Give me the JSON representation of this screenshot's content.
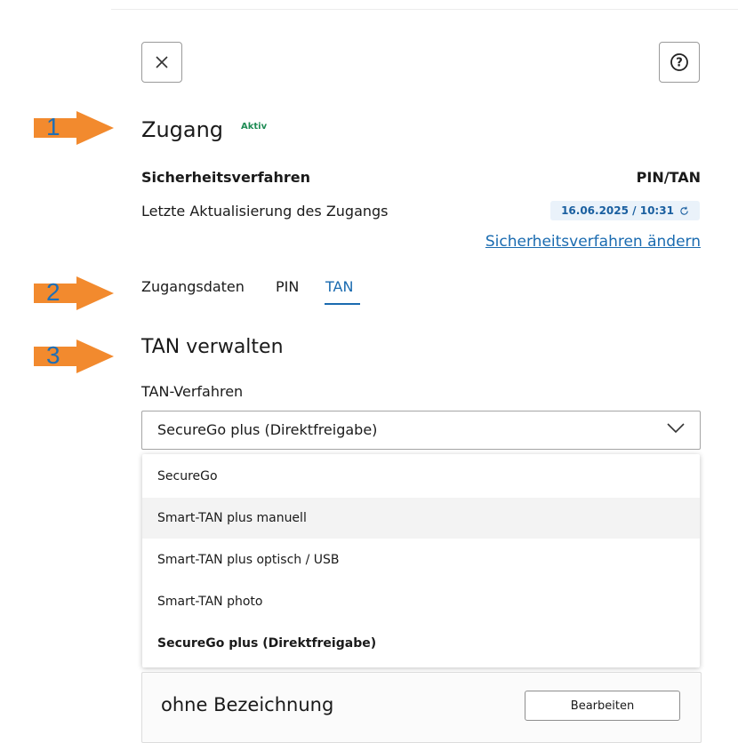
{
  "header": {
    "close_icon": "close-icon",
    "help_icon": "help-icon"
  },
  "markers": [
    "1",
    "2",
    "3"
  ],
  "access": {
    "title": "Zugang",
    "badge": "Aktiv",
    "security_label": "Sicherheitsverfahren",
    "security_value": "PIN/TAN",
    "last_update_label": "Letzte Aktualisierung des Zugangs",
    "last_update_value": "16.06.2025 / 10:31",
    "change_link": "Sicherheitsverfahren ändern"
  },
  "tabs": [
    {
      "label": "Zugangsdaten",
      "active": false
    },
    {
      "label": "PIN",
      "active": false
    },
    {
      "label": "TAN",
      "active": true
    }
  ],
  "tan": {
    "heading": "TAN verwalten",
    "field_label": "TAN-Verfahren",
    "selected": "SecureGo plus (Direktfreigabe)",
    "options": [
      "SecureGo",
      "Smart-TAN plus manuell",
      "Smart-TAN plus optisch / USB",
      "Smart-TAN photo",
      "SecureGo plus (Direktfreigabe)"
    ],
    "hover_index": 1,
    "selected_index": 4
  },
  "device": {
    "name": "ohne Bezeichnung",
    "edit_label": "Bearbeiten"
  },
  "colors": {
    "accent": "#1a6bb0",
    "marker": "#f28a2e",
    "badge": "#1f8c55"
  }
}
